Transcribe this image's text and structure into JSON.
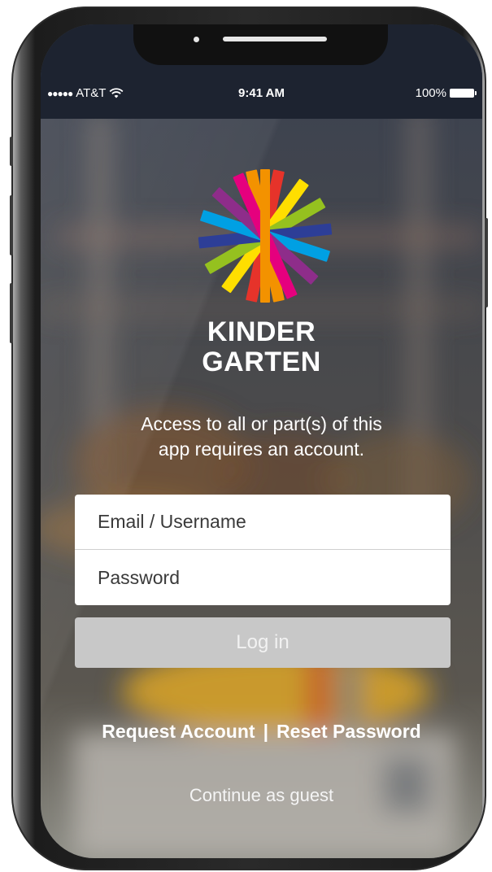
{
  "status_bar": {
    "signal": "●●●●●",
    "carrier": "AT&T",
    "wifi_icon": "wifi-icon",
    "time": "9:41 AM",
    "battery_text": "100%",
    "battery_icon": "battery-icon"
  },
  "app": {
    "logo_icon": "starburst-logo-icon",
    "brand_line1": "KINDER",
    "brand_line2": "GARTEN",
    "notice_line1": "Access to all or part(s) of this",
    "notice_line2": "app requires an account."
  },
  "form": {
    "email_placeholder": "Email / Username",
    "password_placeholder": "Password",
    "login_label": "Log in"
  },
  "links": {
    "request_account": "Request Account",
    "separator": "|",
    "reset_password": "Reset Password",
    "continue_guest": "Continue as guest"
  },
  "colors": {
    "login_button": "#c8c8c8",
    "status_bar": "#1d2330",
    "field_background": "#ffffff",
    "logo_rays": [
      "#e6332a",
      "#f39200",
      "#ffde00",
      "#95c11f",
      "#00a0e3",
      "#2d3e97",
      "#8e2d8a",
      "#e5007e"
    ]
  }
}
